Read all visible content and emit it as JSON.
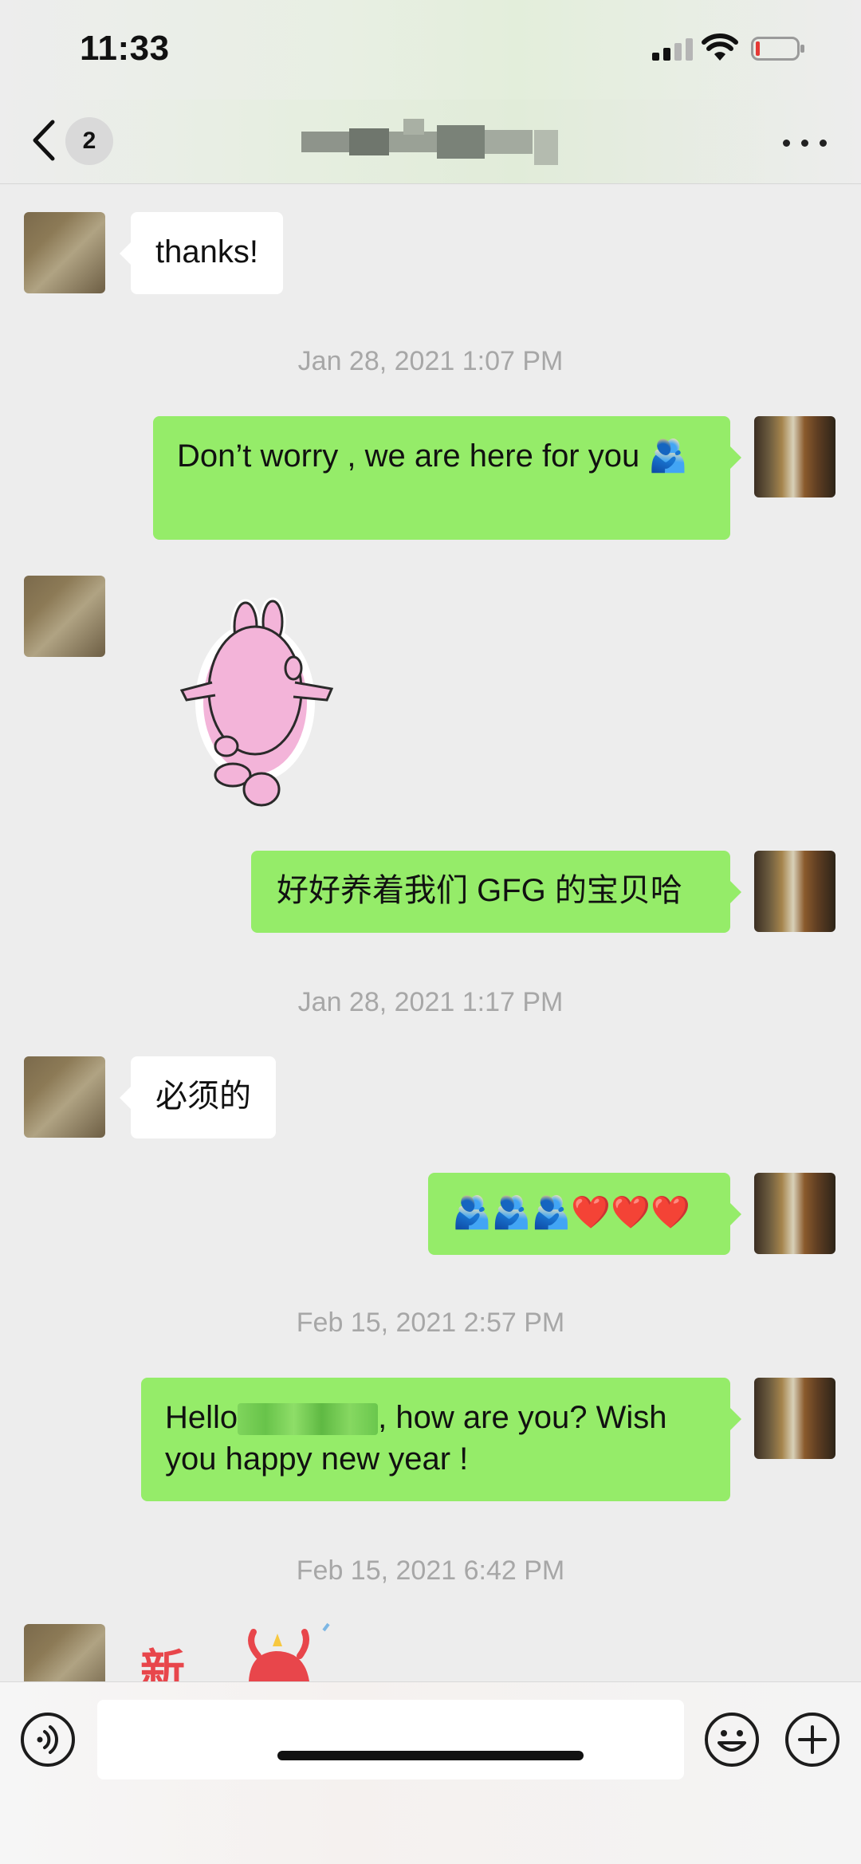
{
  "status_bar": {
    "time": "11:33"
  },
  "nav": {
    "unread_count": "2",
    "more_icon": "ellipsis-icon"
  },
  "messages": [
    {
      "type": "text",
      "side": "in",
      "text": "thanks!"
    },
    {
      "type": "timestamp",
      "text": "Jan 28, 2021 1:07 PM"
    },
    {
      "type": "text",
      "side": "out",
      "text": "Don’t worry , we are here for you 🫂"
    },
    {
      "type": "sticker",
      "side": "in",
      "sticker": "pink-bunny-dancing"
    },
    {
      "type": "text",
      "side": "out",
      "text": "好好养着我们 GFG 的宝贝哈"
    },
    {
      "type": "timestamp",
      "text": "Jan 28, 2021 1:17 PM"
    },
    {
      "type": "text",
      "side": "in",
      "text": "必须的"
    },
    {
      "type": "text",
      "side": "out",
      "text": "🫂🫂🫂❤️❤️❤️"
    },
    {
      "type": "timestamp",
      "text": "Feb 15, 2021 2:57 PM"
    },
    {
      "type": "text",
      "side": "out",
      "text_before": "Hello",
      "text_after": ", how are you? Wish you happy new year !"
    },
    {
      "type": "timestamp",
      "text": "Feb 15, 2021 6:42 PM"
    },
    {
      "type": "sticker",
      "side": "in",
      "sticker": "new-year-sticker",
      "text": "新"
    }
  ],
  "input_bar": {
    "voice_icon": "voice-icon",
    "emoji_icon": "emoji-icon",
    "plus_icon": "plus-icon",
    "value": ""
  },
  "colors": {
    "outgoing_bubble": "#95ec69",
    "incoming_bubble": "#ffffff",
    "background": "#ededed"
  }
}
